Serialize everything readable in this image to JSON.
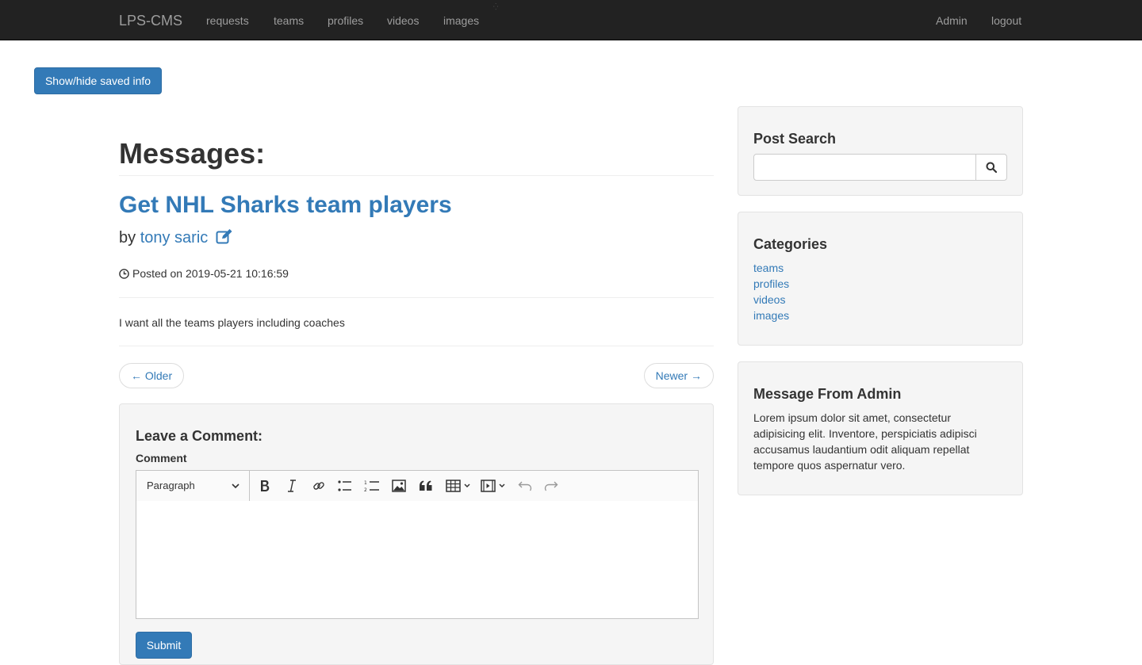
{
  "navbar": {
    "brand": "LPS-CMS",
    "items": [
      "requests",
      "teams",
      "profiles",
      "videos",
      "images"
    ],
    "right_items": [
      "Admin",
      "logout"
    ],
    "background": "#222222"
  },
  "show_hide_label": "Show/hide saved info",
  "main": {
    "page_title": "Messages:",
    "post_title": "Get NHL Sharks team players",
    "by_label": "by",
    "author": "tony saric",
    "posted_on": "Posted on 2019-05-21 10:16:59",
    "body": "I want all the teams players including coaches",
    "older_label": "← Older",
    "newer_label": "Newer →"
  },
  "comment": {
    "title": "Leave a Comment:",
    "label": "Comment",
    "heading_select": "Paragraph",
    "toolbar_icons": [
      "bold-icon",
      "italic-icon",
      "link-icon",
      "bulleted-list-icon",
      "numbered-list-icon",
      "image-icon",
      "blockquote-icon",
      "table-icon",
      "media-icon",
      "undo-icon",
      "redo-icon"
    ],
    "submit_label": "Submit"
  },
  "sidebar": {
    "search_title": "Post Search",
    "search_value": "",
    "categories_title": "Categories",
    "categories": [
      "teams",
      "profiles",
      "videos",
      "images"
    ],
    "admin_title": "Message From Admin",
    "admin_text": "Lorem ipsum dolor sit amet, consectetur adipisicing elit. Inventore, perspiciatis adipisci accusamus laudantium odit aliquam repellat tempore quos aspernatur vero."
  },
  "colors": {
    "link": "#337ab7",
    "primary": "#337ab7",
    "well": "#f5f5f5"
  }
}
